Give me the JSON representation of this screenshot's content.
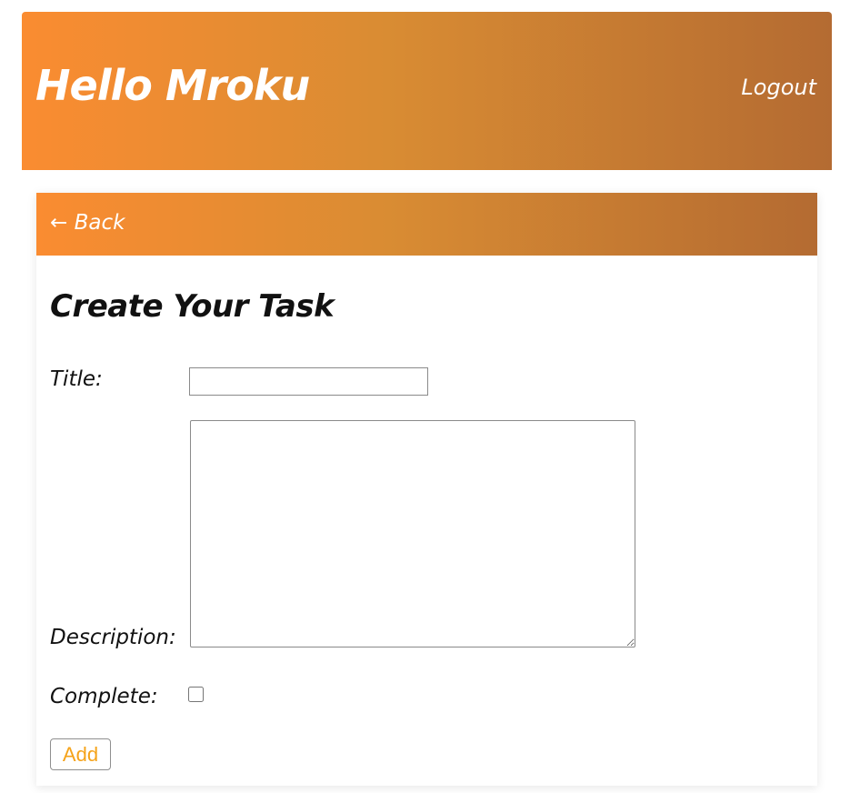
{
  "header": {
    "greeting": "Hello Mroku",
    "logout_label": "Logout"
  },
  "card": {
    "back_label": "← Back",
    "title": "Create Your Task"
  },
  "form": {
    "title_label": "Title:",
    "title_value": "",
    "description_label": "Description:",
    "description_value": "",
    "complete_label": "Complete:",
    "complete_checked": false,
    "add_label": "Add"
  },
  "colors": {
    "gradient_start": "#fa8c31",
    "gradient_end": "#b46b32",
    "button_text": "#f5a31a"
  }
}
